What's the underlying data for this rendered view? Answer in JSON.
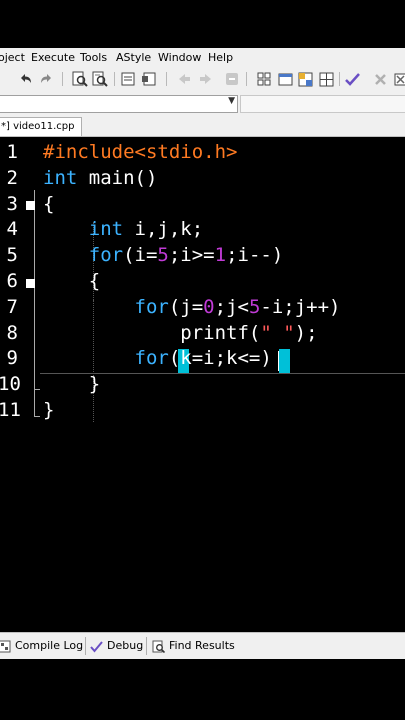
{
  "menu": {
    "items": [
      "oject",
      "Execute",
      "Tools",
      "AStyle",
      "Window",
      "Help"
    ]
  },
  "toolbar": {
    "icons": [
      "undo-icon",
      "redo-icon",
      "search-icon",
      "replace-icon",
      "compile-icon",
      "run-icon",
      "back-icon",
      "forward-icon",
      "stop-icon",
      "grid-icon",
      "window-icon",
      "table-icon",
      "grid-layout-icon",
      "check-icon",
      "close-icon",
      "tools-icon"
    ]
  },
  "tab": {
    "label": "*] video11.cpp"
  },
  "editor": {
    "line_numbers": [
      "1",
      "2",
      "3",
      "4",
      "5",
      "6",
      "7",
      "8",
      "9",
      "10",
      "11"
    ],
    "lines": [
      [
        {
          "t": "#include<stdio.h>",
          "c": "pp"
        }
      ],
      [
        {
          "t": "int",
          "c": "kw"
        },
        {
          "t": " main()",
          "c": ""
        }
      ],
      [
        {
          "t": "{",
          "c": ""
        }
      ],
      [
        {
          "t": "    int",
          "c": "kw"
        },
        {
          "t": " i,j,k;",
          "c": ""
        }
      ],
      [
        {
          "t": "    for",
          "c": "kw"
        },
        {
          "t": "(i=",
          "c": ""
        },
        {
          "t": "5",
          "c": "num"
        },
        {
          "t": ";i>=",
          "c": ""
        },
        {
          "t": "1",
          "c": "num"
        },
        {
          "t": ";i--)",
          "c": ""
        }
      ],
      [
        {
          "t": "    {",
          "c": ""
        }
      ],
      [
        {
          "t": "        for",
          "c": "kw"
        },
        {
          "t": "(j=",
          "c": ""
        },
        {
          "t": "0",
          "c": "num"
        },
        {
          "t": ";j<",
          "c": ""
        },
        {
          "t": "5",
          "c": "num"
        },
        {
          "t": "-i;j++)",
          "c": ""
        }
      ],
      [
        {
          "t": "            printf(",
          "c": ""
        },
        {
          "t": "\" \"",
          "c": "op"
        },
        {
          "t": ");",
          "c": ""
        }
      ],
      [
        {
          "t": "        for",
          "c": "kw"
        },
        {
          "t": "(k=i;k<=)",
          "c": ""
        }
      ],
      [
        {
          "t": "    }",
          "c": ""
        }
      ],
      [
        {
          "t": "}",
          "c": ""
        }
      ]
    ]
  },
  "bottom_tabs": {
    "compile_log": "Compile Log",
    "debug": "Debug",
    "find_results": "Find Results"
  },
  "colors": {
    "preprocessor": "#ff7a22",
    "keyword": "#3cb3ff",
    "number": "#c13bd6",
    "string": "#ff5a5a",
    "bracket_highlight": "#00c0d8"
  }
}
